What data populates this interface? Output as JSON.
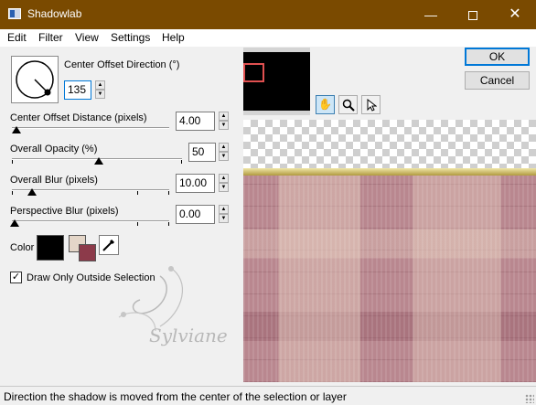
{
  "window": {
    "title": "Shadowlab"
  },
  "menu": [
    "Edit",
    "Filter",
    "View",
    "Settings",
    "Help"
  ],
  "direction": {
    "label": "Center Offset Direction (°)",
    "value": "135"
  },
  "offset_distance": {
    "label": "Center Offset Distance (pixels)",
    "value": "4.00",
    "fraction": 0.04
  },
  "opacity": {
    "label": "Overall Opacity (%)",
    "value": "50",
    "fraction": 0.5
  },
  "overall_blur": {
    "label": "Overall Blur (pixels)",
    "value": "10.00",
    "fraction": 0.1
  },
  "perspective_blur": {
    "label": "Perspective Blur (pixels)",
    "value": "0.00",
    "fraction": 0.0
  },
  "color": {
    "label": "Color",
    "primary": "#000000",
    "swatch_bg": "#e4d6c8",
    "swatch_fg": "#8c3a4a"
  },
  "outside_selection": {
    "label": "Draw Only Outside Selection",
    "checked": true
  },
  "buttons": {
    "ok": "OK",
    "cancel": "Cancel"
  },
  "status": "Direction the shadow is moved from the center of the selection or layer",
  "watermark": "Sylviane",
  "colors": {
    "titlebar": "#7a4a00",
    "preview_rect": "#e05050",
    "texture": "#b9878f"
  }
}
